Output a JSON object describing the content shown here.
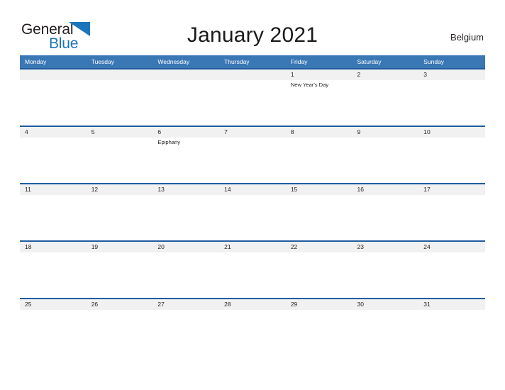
{
  "brand": {
    "name_part1": "General",
    "name_part2": "Blue",
    "flag_icon": "blue-triangle-flag-icon",
    "color_dark": "#231f20",
    "color_blue": "#1b75bb"
  },
  "header": {
    "title": "January 2021",
    "region": "Belgium"
  },
  "calendar": {
    "accent_header_color": "#3a77b5",
    "row_border_color": "#1f5c9e",
    "date_band_color": "#f1f1f1",
    "weekday_headers": [
      "Monday",
      "Tuesday",
      "Wednesday",
      "Thursday",
      "Friday",
      "Saturday",
      "Sunday"
    ],
    "weeks": [
      {
        "days": [
          {
            "date": "",
            "event": ""
          },
          {
            "date": "",
            "event": ""
          },
          {
            "date": "",
            "event": ""
          },
          {
            "date": "",
            "event": ""
          },
          {
            "date": "1",
            "event": "New Year's Day"
          },
          {
            "date": "2",
            "event": ""
          },
          {
            "date": "3",
            "event": ""
          }
        ]
      },
      {
        "days": [
          {
            "date": "4",
            "event": ""
          },
          {
            "date": "5",
            "event": ""
          },
          {
            "date": "6",
            "event": "Epiphany"
          },
          {
            "date": "7",
            "event": ""
          },
          {
            "date": "8",
            "event": ""
          },
          {
            "date": "9",
            "event": ""
          },
          {
            "date": "10",
            "event": ""
          }
        ]
      },
      {
        "days": [
          {
            "date": "11",
            "event": ""
          },
          {
            "date": "12",
            "event": ""
          },
          {
            "date": "13",
            "event": ""
          },
          {
            "date": "14",
            "event": ""
          },
          {
            "date": "15",
            "event": ""
          },
          {
            "date": "16",
            "event": ""
          },
          {
            "date": "17",
            "event": ""
          }
        ]
      },
      {
        "days": [
          {
            "date": "18",
            "event": ""
          },
          {
            "date": "19",
            "event": ""
          },
          {
            "date": "20",
            "event": ""
          },
          {
            "date": "21",
            "event": ""
          },
          {
            "date": "22",
            "event": ""
          },
          {
            "date": "23",
            "event": ""
          },
          {
            "date": "24",
            "event": ""
          }
        ]
      },
      {
        "days": [
          {
            "date": "25",
            "event": ""
          },
          {
            "date": "26",
            "event": ""
          },
          {
            "date": "27",
            "event": ""
          },
          {
            "date": "28",
            "event": ""
          },
          {
            "date": "29",
            "event": ""
          },
          {
            "date": "30",
            "event": ""
          },
          {
            "date": "31",
            "event": ""
          }
        ]
      }
    ]
  }
}
